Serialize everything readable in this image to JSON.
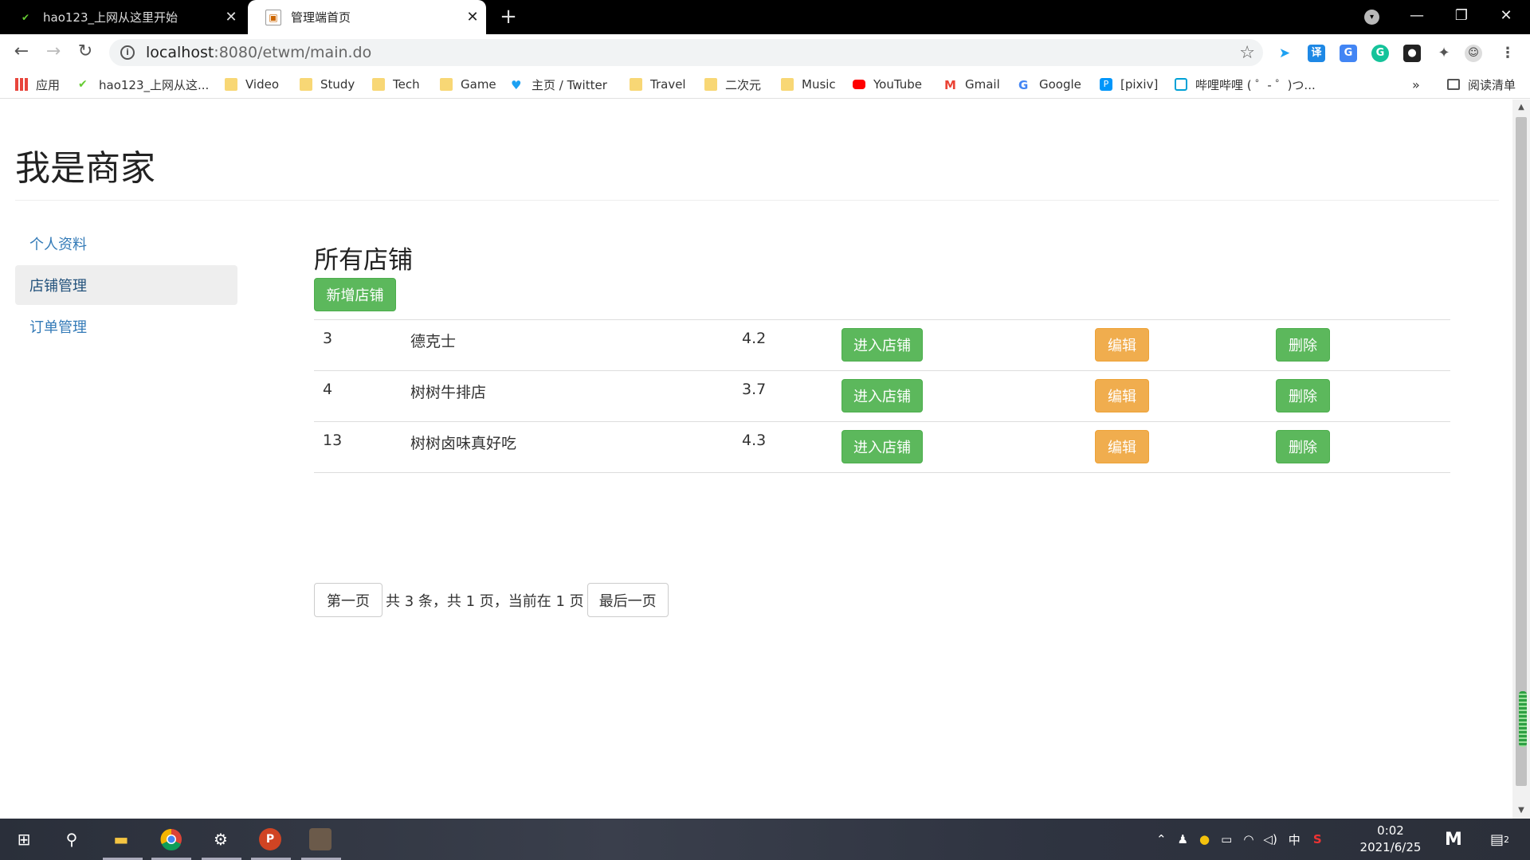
{
  "browser": {
    "tabs": [
      {
        "title": "hao123_上网从这里开始",
        "active": false
      },
      {
        "title": "管理端首页",
        "active": true
      }
    ],
    "url_host": "localhost",
    "url_rest": ":8080/etwm/main.do"
  },
  "bookmarks": [
    {
      "label": "应用"
    },
    {
      "label": "hao123_上网从这..."
    },
    {
      "label": "Video"
    },
    {
      "label": "Study"
    },
    {
      "label": "Tech"
    },
    {
      "label": "Game"
    },
    {
      "label": "主页 / Twitter"
    },
    {
      "label": "Travel"
    },
    {
      "label": "二次元"
    },
    {
      "label": "Music"
    },
    {
      "label": "YouTube"
    },
    {
      "label": "Gmail"
    },
    {
      "label": "Google"
    },
    {
      "label": "[pixiv]"
    },
    {
      "label": "哔哩哔哩 ( ゜- ゜)つ..."
    }
  ],
  "reading_list": "阅读清单",
  "page": {
    "title": "我是商家",
    "sidenav": [
      {
        "label": "个人资料",
        "active": false
      },
      {
        "label": "店铺管理",
        "active": true
      },
      {
        "label": "订单管理",
        "active": false
      }
    ],
    "section_title": "所有店铺",
    "add_button": "新增店铺",
    "shops": [
      {
        "id": "3",
        "name": "德克士",
        "score": "4.2"
      },
      {
        "id": "4",
        "name": "树树牛排店",
        "score": "3.7"
      },
      {
        "id": "13",
        "name": "树树卤味真好吃",
        "score": "4.3"
      }
    ],
    "row_actions": {
      "enter": "进入店铺",
      "edit": "编辑",
      "delete": "删除"
    },
    "pager": {
      "first": "第一页",
      "info": "共 3 条，共 1 页，当前在 1 页",
      "last": "最后一页"
    }
  },
  "taskbar": {
    "time": "0:02",
    "date": "2021/6/25",
    "ime": "中",
    "notifications": "2"
  },
  "colors": {
    "success": "#5cb85c",
    "warning": "#f0ad4e",
    "link": "#337ab7"
  }
}
